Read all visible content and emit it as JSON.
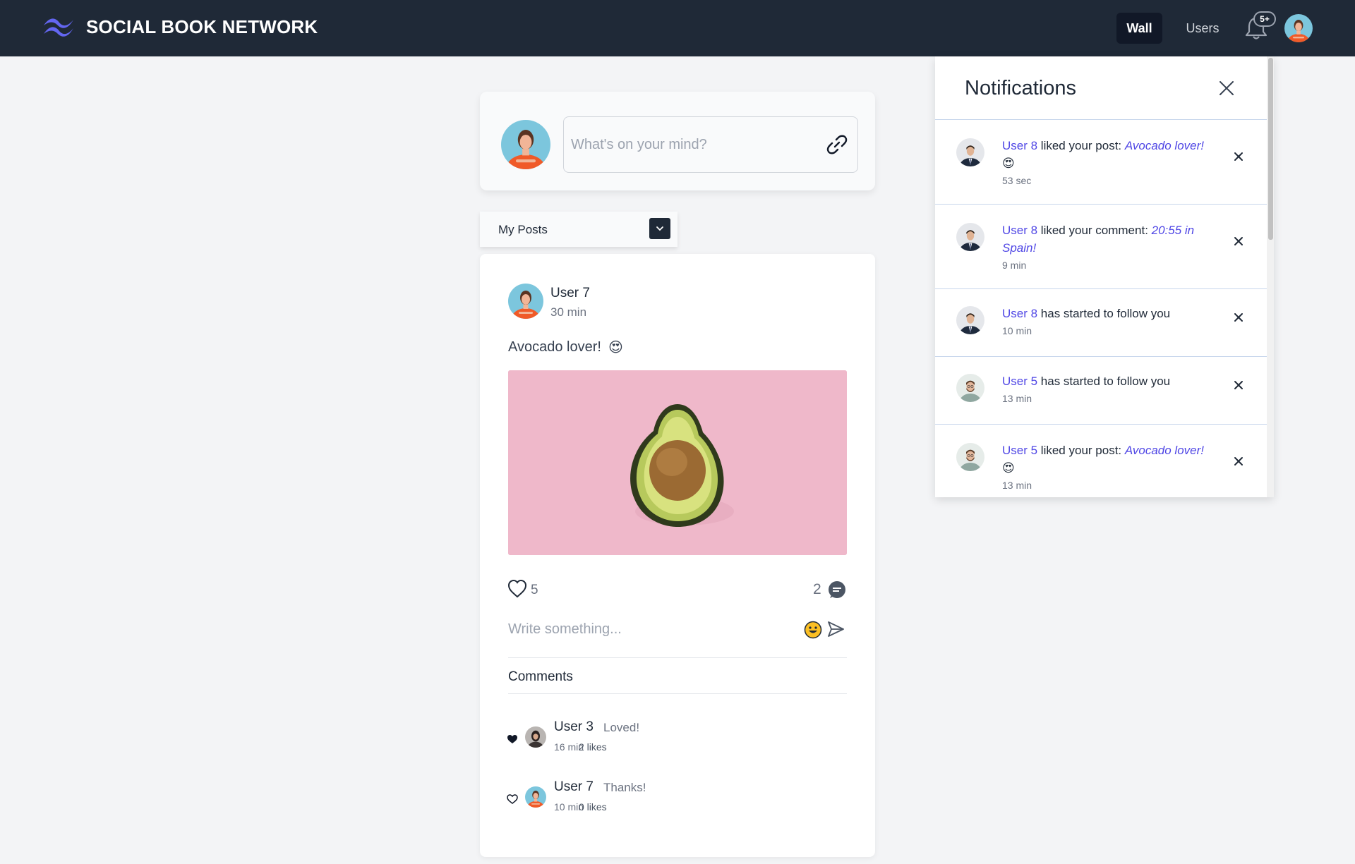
{
  "header": {
    "brand": "SOCIAL BOOK NETWORK",
    "nav": {
      "wall": "Wall",
      "users": "Users"
    },
    "notification_badge": "5+",
    "colors": {
      "bar": "#1f2937",
      "accent": "#4f46e5"
    }
  },
  "composer": {
    "placeholder": "What's on your mind?",
    "attach_icon": "link-icon"
  },
  "filter": {
    "selected": "My Posts"
  },
  "post": {
    "author": "User 7",
    "time": "30 min",
    "text": "Avocado lover!",
    "emoji": "😍",
    "likes": "5",
    "comments_count": "2",
    "write_placeholder": "Write something...",
    "comments_title": "Comments",
    "comments": [
      {
        "author": "User 3",
        "text": "Loved!",
        "time": "16 min",
        "likes": "2 likes",
        "liked": true
      },
      {
        "author": "User 7",
        "text": "Thanks!",
        "time": "10 min",
        "likes": "0 likes",
        "liked": false
      }
    ]
  },
  "notifications": {
    "title": "Notifications",
    "items": [
      {
        "user": "User 8",
        "action": " liked your post: ",
        "target": "Avocado lover!",
        "emoji": "😍",
        "time": "53 sec"
      },
      {
        "user": "User 8",
        "action": " liked your comment: ",
        "target": "20:55 in Spain!",
        "emoji": "",
        "time": "9 min"
      },
      {
        "user": "User 8",
        "action": " has started to follow you",
        "target": "",
        "emoji": "",
        "time": "10 min"
      },
      {
        "user": "User 5",
        "action": " has started to follow you",
        "target": "",
        "emoji": "",
        "time": "13 min"
      },
      {
        "user": "User 5",
        "action": " liked your post: ",
        "target": "Avocado lover!",
        "emoji": "😍",
        "time": "13 min"
      }
    ]
  }
}
